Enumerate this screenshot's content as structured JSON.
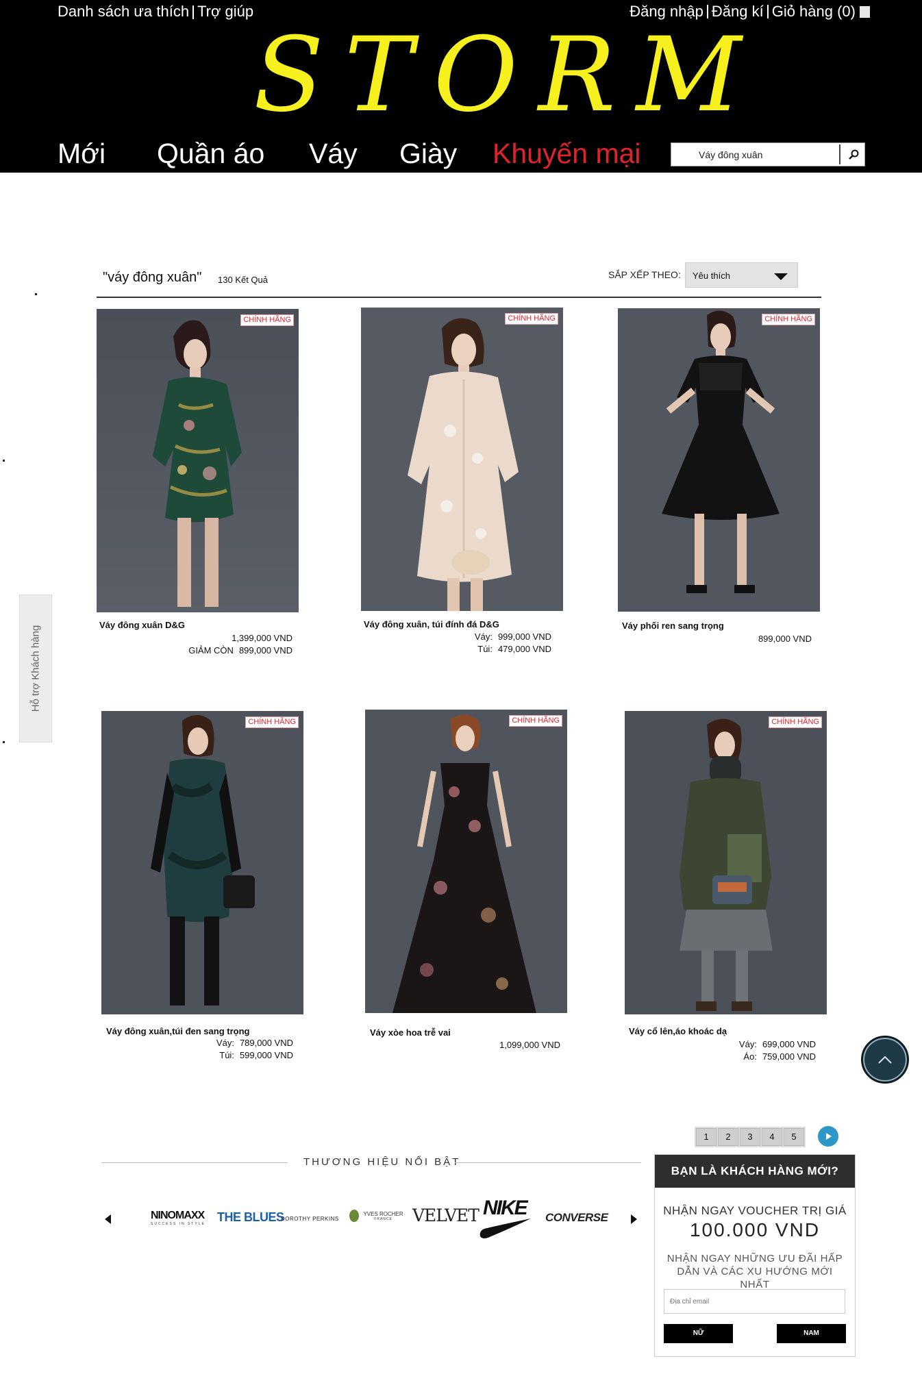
{
  "header": {
    "top_left": {
      "wishlist": "Danh sách ưa thích",
      "help": "Trợ giúp"
    },
    "top_right": {
      "login": "Đăng nhập",
      "register": "Đăng kí",
      "cart": "Giỏ hàng (0)"
    },
    "logo": "STORM",
    "nav": [
      "Mới",
      "Quần áo",
      "Váy",
      "Giày",
      "Khuyến mại"
    ],
    "search_value": "Váy đông xuân",
    "colors": {
      "background": "#000000",
      "logo": "#f7f01f",
      "promo": "#e2222b"
    }
  },
  "results": {
    "query": "\"váy đông xuân\"",
    "count": "130 Kết Quả",
    "sort_label": "SẮP XẾP THEO:",
    "sort_value": "Yêu thích"
  },
  "badge": "CHÍNH HÃNG",
  "products": [
    {
      "name": "Váy đông xuân D&G",
      "lines": [
        {
          "label": "",
          "value": "1,399,000 VND"
        },
        {
          "label": "GIẢM CÒN",
          "value": "899,000 VND"
        }
      ],
      "image": "model-green-embroidered-dress"
    },
    {
      "name": "Váy đông xuân, túi đính đá D&G",
      "lines": [
        {
          "label": "Váy:",
          "value": "999,000 VND"
        },
        {
          "label": "Túi:",
          "value": "479,000 VND"
        }
      ],
      "image": "model-cream-coat-dress"
    },
    {
      "name": "Váy phối ren sang trọng",
      "lines": [
        {
          "label": "",
          "value": "899,000 VND"
        }
      ],
      "image": "model-black-lace-dress"
    },
    {
      "name": "Váy đông xuân,túi đen sang trọng",
      "lines": [
        {
          "label": "Váy:",
          "value": "789,000 VND"
        },
        {
          "label": "Túi:",
          "value": "599,000 VND"
        }
      ],
      "image": "model-teal-dress-black-bag"
    },
    {
      "name": "Váy xòe hoa trễ vai",
      "lines": [
        {
          "label": "",
          "value": "1,099,000 VND"
        }
      ],
      "image": "model-floral-gown"
    },
    {
      "name": "Váy cổ lên,áo khoác dạ",
      "lines": [
        {
          "label": "Váy:",
          "value": "699,000 VND"
        },
        {
          "label": "Áo:",
          "value": "759,000 VND"
        }
      ],
      "image": "model-olive-coat"
    }
  ],
  "support_tab": "Hỗ trợ Khách hàng",
  "pagination": {
    "pages": [
      "1",
      "2",
      "3",
      "4",
      "5"
    ],
    "next_icon": "play-icon"
  },
  "brands": {
    "title": "THƯƠNG HIỆU NỔI BẬT",
    "items": [
      "NINOMAXX",
      "THE BLUES",
      "DOROTHY PERKINS",
      "YVES ROCHER",
      "VELVET",
      "NIKE",
      "CONVERSE"
    ],
    "sub": {
      "ninomaxx": "SUCCESS IN STYLE",
      "yves": "FRANCE"
    }
  },
  "newsletter": {
    "title": "BẠN LÀ KHÁCH HÀNG MỚI?",
    "line1": "NHẬN NGAY VOUCHER TRỊ GIÁ",
    "amount": "100.000 VND",
    "desc": "NHẬN NGAY NHỮNG ƯU ĐÃI HẤP DẪN VÀ CÁC XU HƯỚNG MỚI NHẤT",
    "email_placeholder": "Địa chỉ email",
    "female_btn": "NỮ",
    "male_btn": "NAM"
  }
}
